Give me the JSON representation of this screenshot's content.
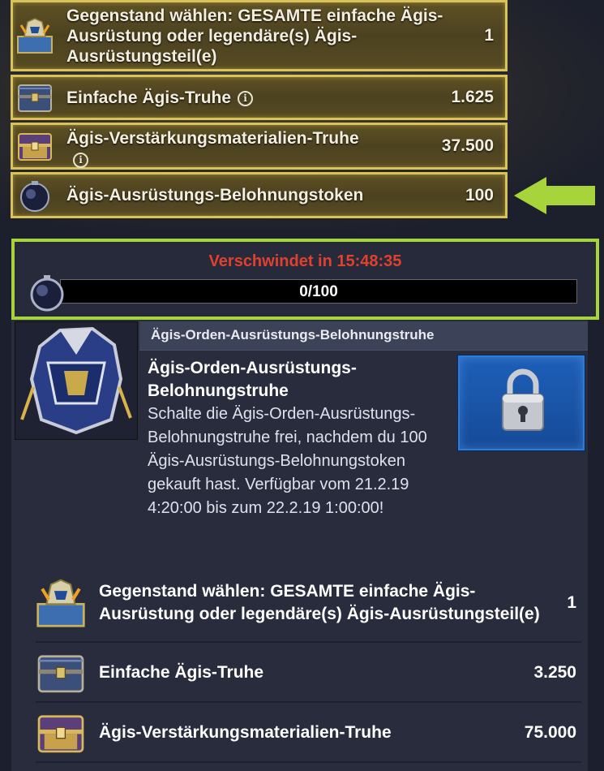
{
  "top_rewards": [
    {
      "icon": "hero-chest-icon",
      "label": "Gegenstand wählen: GESAMTE einfache Ägis-Ausrüstung oder legendäre(s) Ägis-Ausrüstungsteil(e)",
      "qty": "1"
    },
    {
      "icon": "aegis-chest-icon",
      "label": "Einfache Ägis-Truhe",
      "qty": "1.625",
      "info": "i"
    },
    {
      "icon": "gold-chest-icon",
      "label": "Ägis-Verstärkungsmaterialien-Truhe",
      "qty": "37.500",
      "info": "i"
    },
    {
      "icon": "token-orb-icon",
      "label": "Ägis-Ausrüstungs-Belohnungstoken",
      "qty": "100"
    }
  ],
  "timer": {
    "text": "Verschwindet in 15:48:35",
    "progress_label": "0/100",
    "progress": 0.0
  },
  "panel": {
    "header": "Ägis-Orden-Ausrüstungs-Belohnungstruhe",
    "title": "Ägis-Orden-Ausrüstungs-Belohnungstruhe",
    "description": "Schalte die Ägis-Orden-Ausrüstungs-Belohnungstruhe frei, nachdem du 100 Ägis-Ausrüstungs-Belohnungstoken gekauft hast. Verfügbar vom 21.2.19 4:20:00 bis zum 22.2.19 1:00:00!",
    "rewards": [
      {
        "icon": "hero-chest-icon",
        "label": "Gegenstand wählen: GESAMTE einfache Ägis-Ausrüstung oder legendäre(s) Ägis-Ausrüstungsteil(e)",
        "qty": "1"
      },
      {
        "icon": "aegis-chest-icon",
        "label": "Einfache Ägis-Truhe",
        "qty": "3.250"
      },
      {
        "icon": "gold-chest-icon",
        "label": "Ägis-Verstärkungsmaterialien-Truhe",
        "qty": "75.000"
      }
    ]
  },
  "colors": {
    "gold_border": "#d9c257",
    "highlight_green": "#a7d43a",
    "timer_red": "#e0412e",
    "lock_blue": "#1e5fb8"
  }
}
